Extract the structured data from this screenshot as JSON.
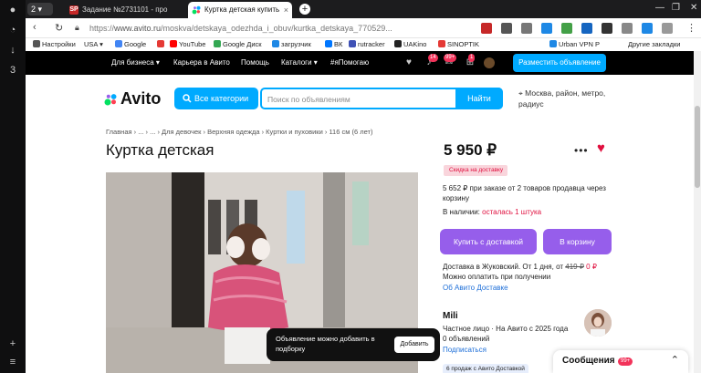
{
  "browser": {
    "tab_counter": "2",
    "tabs": [
      {
        "label": "Задание №2731101 - про",
        "favicon": "SP",
        "active": false
      },
      {
        "label": "Куртка детская купить",
        "favicon": "avito",
        "active": true
      }
    ],
    "close_glyph": "×",
    "new_tab_glyph": "+",
    "url_scheme": "https://",
    "url_host": "www.avito.ru",
    "url_path": "/moskva/detskaya_odezhda_i_obuv/kurtka_detskaya_770529..."
  },
  "bookmarks": [
    {
      "label": "Настройки",
      "color": "#555555"
    },
    {
      "label": "USA",
      "color": "#555555"
    },
    {
      "label": "Google",
      "color": "#4285f4"
    },
    {
      "label": "",
      "color": "#e53935"
    },
    {
      "label": "YouTube",
      "color": "#ff0000"
    },
    {
      "label": "Google Диск",
      "color": "#34a853"
    },
    {
      "label": "загрузчик",
      "color": "#1e88e5"
    },
    {
      "label": "ВК",
      "color": "#0077ff"
    },
    {
      "label": "rutracker",
      "color": "#3f51b5"
    },
    {
      "label": "UAKino",
      "color": "#222222"
    },
    {
      "label": "SINOPTIK",
      "color": "#e53935"
    },
    {
      "label": "Urban VPN P",
      "color": "#1e88e5"
    },
    {
      "label": "Другие закладки",
      "color": "#555555"
    }
  ],
  "site_header": {
    "links": [
      "Для бизнеса",
      "Карьера в Авито",
      "Помощь",
      "Каталоги",
      "#яПомогаю"
    ],
    "notifications_badge": "14",
    "messages_badge": "99+",
    "cart_badge": "1",
    "post_button": "Разместить объявление"
  },
  "search": {
    "logo": "Avito",
    "all_categories": "Все категории",
    "placeholder": "Поиск по объявлениям",
    "find_button": "Найти",
    "location": "Москва, район, метро, радиус"
  },
  "listing": {
    "breadcrumbs": "Главная › ... › ... › Для девочек › Верхняя одежда › Куртки и пуховики › 116 см (6 лет)",
    "title": "Куртка детская",
    "price": "5 950 ₽",
    "discount_badge": "Скидка на доставку",
    "bundle_offer": "5 652 ₽ при заказе от 2 товаров продавца через корзину",
    "availability_prefix": "В наличии:",
    "availability_value": "осталась 1 штука",
    "buy_delivery_button": "Купить с доставкой",
    "to_cart_button": "В корзину",
    "delivery_text": "Доставка в Жуковский. От 1 дня, от",
    "delivery_old": "419 ₽",
    "delivery_new": "0 ₽",
    "payment_text": "Можно оплатить при получении",
    "delivery_link": "Об Авито Доставке"
  },
  "seller": {
    "name": "Mili",
    "status": "Частное лицо · На Авито с 2025 года",
    "ads": "0 объявлений",
    "subscribe": "Подписаться",
    "sales_badge": "6 продаж с Авито Доставкой"
  },
  "toast": {
    "text": "Объявление можно добавить в подборку",
    "button": "Добавить"
  },
  "messages": {
    "label": "Сообщения",
    "badge": "99+"
  }
}
